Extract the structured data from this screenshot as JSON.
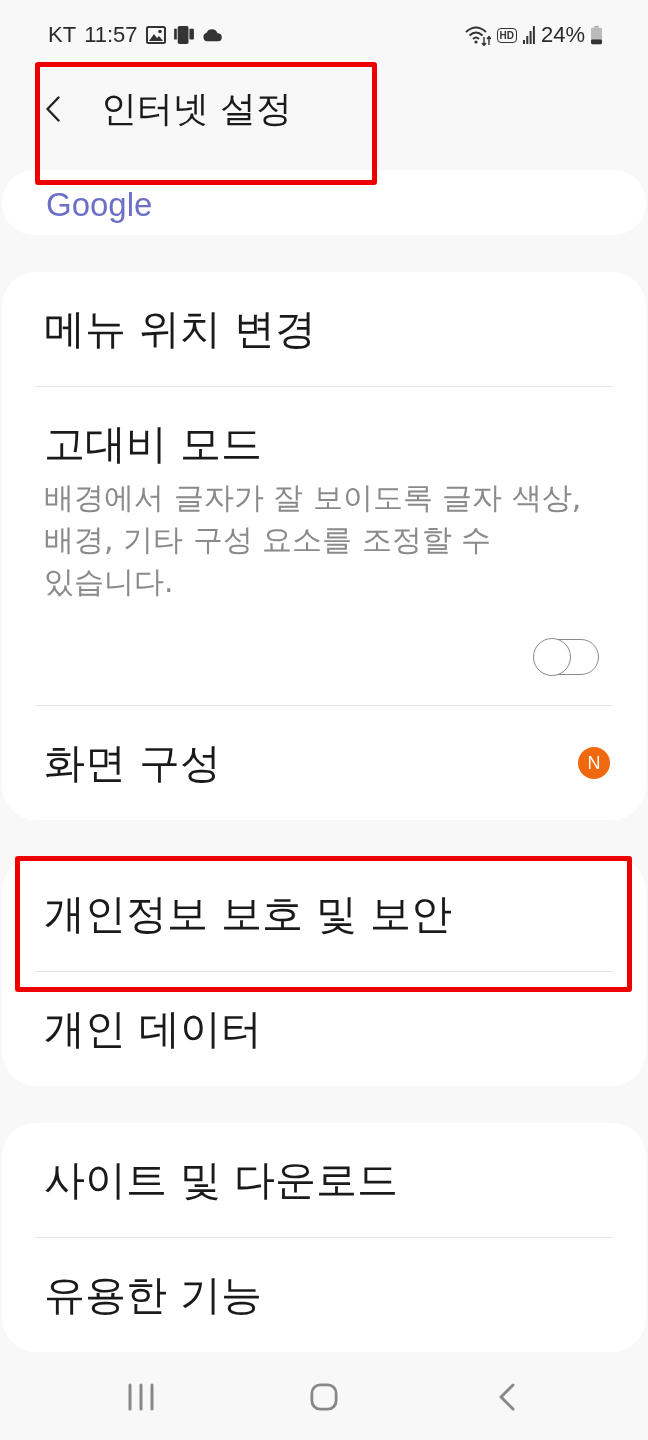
{
  "status_bar": {
    "carrier": "KT",
    "time": "11:57",
    "call_quality": "HD",
    "battery": "24%"
  },
  "header": {
    "title": "인터넷 설정",
    "highlighted": true
  },
  "groups": [
    {
      "items": [
        {
          "kind": "link",
          "title": "Google",
          "highlighted": false
        }
      ]
    },
    {
      "items": [
        {
          "kind": "plain",
          "title": "메뉴 위치 변경",
          "highlighted": false
        },
        {
          "kind": "toggle",
          "title": "고대비 모드",
          "description": "배경에서 글자가 잘 보이도록 글자 색상, 배경, 기타 구성 요소를 조정할 수 있습니다.",
          "on": false,
          "highlighted": false
        },
        {
          "kind": "badge",
          "title": "화면 구성",
          "badge": "N",
          "highlighted": false
        }
      ]
    },
    {
      "items": [
        {
          "kind": "plain",
          "title": "개인정보 보호 및 보안",
          "highlighted": true
        },
        {
          "kind": "plain",
          "title": "개인 데이터",
          "highlighted": false
        }
      ]
    },
    {
      "items": [
        {
          "kind": "plain",
          "title": "사이트 및 다운로드",
          "highlighted": false
        },
        {
          "kind": "plain",
          "title": "유용한 기능",
          "highlighted": false
        }
      ]
    }
  ]
}
